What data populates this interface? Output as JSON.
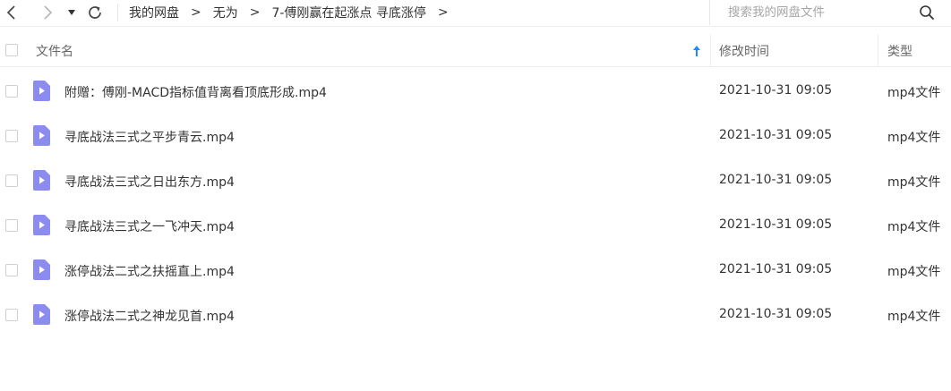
{
  "nav": {
    "breadcrumb": [
      "我的网盘",
      "无为",
      "7-傅刚赢在起涨点 寻底涨停"
    ],
    "separator": ">"
  },
  "search": {
    "placeholder": "搜索我的网盘文件"
  },
  "table": {
    "columns": {
      "name": "文件名",
      "modified": "修改时间",
      "type": "类型"
    },
    "rows": [
      {
        "name": "附赠：傅刚-MACD指标值背离看顶底形成.mp4",
        "modified": "2021-10-31 09:05",
        "type": "mp4文件"
      },
      {
        "name": "寻底战法三式之平步青云.mp4",
        "modified": "2021-10-31 09:05",
        "type": "mp4文件"
      },
      {
        "name": "寻底战法三式之日出东方.mp4",
        "modified": "2021-10-31 09:05",
        "type": "mp4文件"
      },
      {
        "name": "寻底战法三式之一飞冲天.mp4",
        "modified": "2021-10-31 09:05",
        "type": "mp4文件"
      },
      {
        "name": "涨停战法二式之扶摇直上.mp4",
        "modified": "2021-10-31 09:05",
        "type": "mp4文件"
      },
      {
        "name": "涨停战法二式之神龙见首.mp4",
        "modified": "2021-10-31 09:05",
        "type": "mp4文件"
      }
    ]
  },
  "colors": {
    "video_icon": "#8c8cf0",
    "sort_arrow": "#1a8cff"
  },
  "icons": [
    "back-icon",
    "forward-icon",
    "dropdown-icon",
    "refresh-icon",
    "search-icon",
    "sort-ascending-icon",
    "video-file-icon"
  ]
}
